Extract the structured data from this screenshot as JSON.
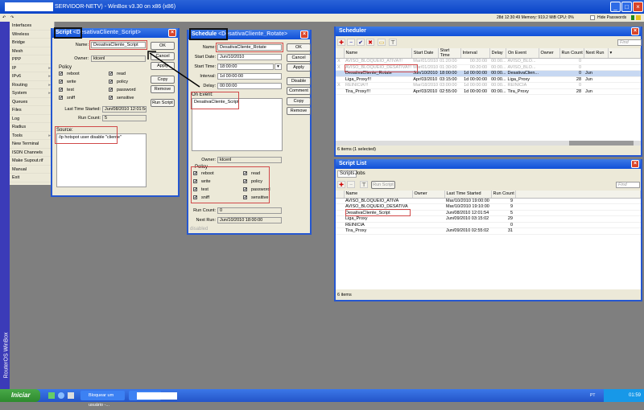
{
  "app": {
    "title": "SERVIDOR-NETV) - WinBox v3.30 on x86 (x86)",
    "side_label": "RouterOS WinBox"
  },
  "toolbar": {
    "undo": "↶",
    "redo": "↷",
    "status": "28d 12:30:49  Memory: 919.2 MiB  CPU: 0%",
    "hide_passwords": "Hide Passwords"
  },
  "menu": [
    {
      "label": "Interfaces"
    },
    {
      "label": "Wireless"
    },
    {
      "label": "Bridge"
    },
    {
      "label": "Mesh"
    },
    {
      "label": "PPP"
    },
    {
      "label": "IP",
      "sub": true
    },
    {
      "label": "IPv6",
      "sub": true
    },
    {
      "label": "Routing",
      "sub": true
    },
    {
      "label": "System",
      "sub": true
    },
    {
      "label": "Queues"
    },
    {
      "label": "Files"
    },
    {
      "label": "Log"
    },
    {
      "label": "Radius"
    },
    {
      "label": "Tools",
      "sub": true
    },
    {
      "label": "New Terminal"
    },
    {
      "label": "ISDN Channels"
    },
    {
      "label": "Make Supout.rif"
    },
    {
      "label": "Manual"
    },
    {
      "label": "Exit"
    }
  ],
  "script_win": {
    "title_a": "Script",
    "title_b": "<DesativaCliente_Script>",
    "name_label": "Name:",
    "name": "DesativaCliente_Script",
    "owner_label": "Owner:",
    "owner": "ktcenl",
    "policy_label": "Policy",
    "policies": [
      "reboot",
      "read",
      "write",
      "policy",
      "test",
      "password",
      "sniff",
      "sensitive"
    ],
    "last_label": "Last Time Started:",
    "last": "Jun/08/2010 12:01:54",
    "count_label": "Run Count:",
    "count": "5",
    "source_label": "Source:",
    "source": "/ip hotspot user disable \"cliente\"",
    "buttons": [
      "OK",
      "Cancel",
      "Apply",
      "Copy",
      "Remove",
      "Run Script"
    ]
  },
  "schedule_win": {
    "title_a": "Schedule",
    "title_b": "<DesativaCliente_Rotate>",
    "name_label": "Name:",
    "name": "DesativaCliente_Rotate",
    "start_date_label": "Start Date:",
    "start_date": "Jun/10/2010",
    "start_time_label": "Start Time:",
    "start_time": "18:00:00",
    "interval_label": "Interval:",
    "interval": "1d 00:00:00",
    "delay_label": "Delay:",
    "delay": "00:00:00",
    "on_event_label": "On Event:",
    "on_event": "DesativaCliente_Script",
    "owner_label": "Owner:",
    "owner": "ktcenl",
    "policy_label": "Policy",
    "policies": [
      "reboot",
      "read",
      "write",
      "policy",
      "test",
      "password",
      "sniff",
      "sensitive"
    ],
    "count_label": "Run Count:",
    "count": "0",
    "next_label": "Next Run:",
    "next": "Jun/10/2010 18:00:00",
    "status": "disabled",
    "buttons": [
      "OK",
      "Cancel",
      "Apply",
      "Disable",
      "Comment",
      "Copy",
      "Remove"
    ]
  },
  "scheduler": {
    "title": "Scheduler",
    "find": "Find",
    "columns": [
      "Name",
      "Start Date",
      "Start Time",
      "Interval",
      "Delay",
      "On Event",
      "Owner",
      "Run Count",
      "Next Run"
    ],
    "rows": [
      {
        "flag": "X",
        "name": "AVISO_BLOQUEIO_ATIVA!!!",
        "date": "Mar/01/2010",
        "time": "01:20:00",
        "interval": "00:20:00",
        "delay": "00:00...",
        "event": "AVISO_BLO...",
        "owner": "",
        "count": "0",
        "next": "",
        "state": "dis"
      },
      {
        "flag": "X",
        "name": "AVISO_BLOQUEIO_DESATIVA!!!",
        "date": "Mar/01/2010",
        "time": "01:30:00",
        "interval": "00:20:00",
        "delay": "00:00...",
        "event": "AVISO_BLO...",
        "owner": "",
        "count": "0",
        "next": "",
        "state": "dis"
      },
      {
        "flag": "",
        "name": "DesativaCliente_Rotate",
        "date": "Jun/10/2010",
        "time": "18:00:00",
        "interval": "1d 00:00:00",
        "delay": "00:00...",
        "event": "DesativaClien...",
        "owner": "",
        "count": "0",
        "next": "Jun",
        "state": "sel"
      },
      {
        "flag": "",
        "name": "Liga_Proxy!!!",
        "date": "Apr/03/2010",
        "time": "03:15:00",
        "interval": "1d 00:00:00",
        "delay": "00:00...",
        "event": "Liga_Proxy",
        "owner": "",
        "count": "28",
        "next": "Jun",
        "state": ""
      },
      {
        "flag": "X",
        "name": "REINICIA!!!",
        "date": "Mar/18/2010",
        "time": "03:00:00",
        "interval": "1d 00:00:00",
        "delay": "00:00...",
        "event": "REINICIA",
        "owner": "",
        "count": "0",
        "next": "",
        "state": "dis"
      },
      {
        "flag": "",
        "name": "Tira_Proxy!!!",
        "date": "Apr/03/2010",
        "time": "02:55:00",
        "interval": "1d 00:00:00",
        "delay": "00:00...",
        "event": "Tira_Proxy",
        "owner": "",
        "count": "28",
        "next": "Jun",
        "state": ""
      }
    ],
    "status": "6 items (1 selected)"
  },
  "script_list": {
    "title": "Script List",
    "tabs": [
      "Scripts",
      "Jobs"
    ],
    "run_script": "Run Script",
    "find": "Find",
    "columns": [
      "Name",
      "Owner",
      "Last Time Started",
      "Run Count"
    ],
    "rows": [
      {
        "name": "AVISO_BLOQUEIO_ATIVA",
        "owner": "",
        "last": "Mar/10/2010 19:00:00",
        "count": "9"
      },
      {
        "name": "AVISO_BLOQUEIO_DESATIVA",
        "owner": "",
        "last": "Mar/10/2010 19:10:00",
        "count": "9"
      },
      {
        "name": "DesativaCliente_Script",
        "owner": "",
        "last": "Jun/08/2010 12:01:54",
        "count": "5"
      },
      {
        "name": "Liga_Proxy",
        "owner": "",
        "last": "Jun/09/2010 03:15:02",
        "count": "29"
      },
      {
        "name": "REINICIA",
        "owner": "",
        "last": "",
        "count": "0"
      },
      {
        "name": "Tira_Proxy",
        "owner": "",
        "last": "Jun/09/2010 02:55:02",
        "count": "31"
      }
    ],
    "status": "6 items"
  },
  "taskbar": {
    "start": "Iniciar",
    "task1": "Bloquear um usuário -...",
    "clock": "01:59",
    "lang": "PT"
  }
}
